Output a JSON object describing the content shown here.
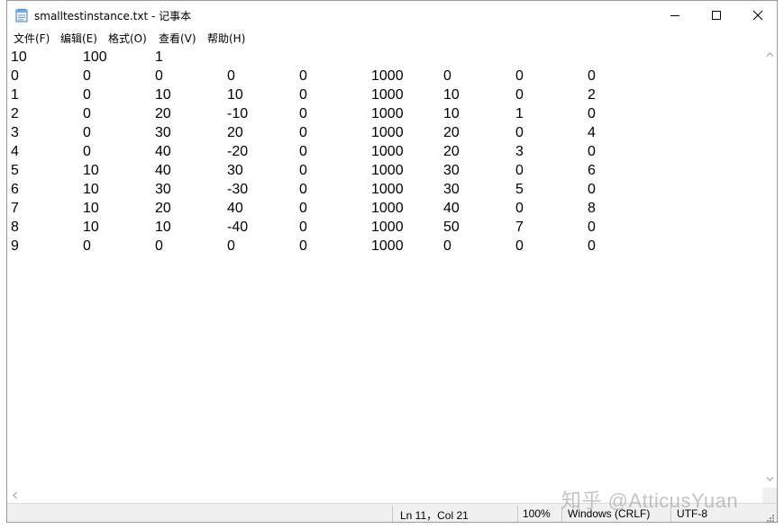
{
  "window": {
    "title": "smalltestinstance.txt - 记事本",
    "icon": "notepad-icon"
  },
  "menu": [
    {
      "label": "文件(F)"
    },
    {
      "label": "编辑(E)"
    },
    {
      "label": "格式(O)"
    },
    {
      "label": "查看(V)"
    },
    {
      "label": "帮助(H)"
    }
  ],
  "content": {
    "rows": [
      [
        "10",
        "100",
        "1"
      ],
      [
        "0",
        "0",
        "0",
        "0",
        "0",
        "1000",
        "0",
        "0",
        "0"
      ],
      [
        "1",
        "0",
        "10",
        "10",
        "0",
        "1000",
        "10",
        "0",
        "2"
      ],
      [
        "2",
        "0",
        "20",
        "-10",
        "0",
        "1000",
        "10",
        "1",
        "0"
      ],
      [
        "3",
        "0",
        "30",
        "20",
        "0",
        "1000",
        "20",
        "0",
        "4"
      ],
      [
        "4",
        "0",
        "40",
        "-20",
        "0",
        "1000",
        "20",
        "3",
        "0"
      ],
      [
        "5",
        "10",
        "40",
        "30",
        "0",
        "1000",
        "30",
        "0",
        "6"
      ],
      [
        "6",
        "10",
        "30",
        "-30",
        "0",
        "1000",
        "30",
        "5",
        "0"
      ],
      [
        "7",
        "10",
        "20",
        "40",
        "0",
        "1000",
        "40",
        "0",
        "8"
      ],
      [
        "8",
        "10",
        "10",
        "-40",
        "0",
        "1000",
        "50",
        "7",
        "0"
      ],
      [
        "9",
        "0",
        "0",
        "0",
        "0",
        "1000",
        "0",
        "0",
        "0"
      ]
    ]
  },
  "status": {
    "position": "Ln 11，Col 21",
    "zoom": "100%",
    "line_ending": "Windows (CRLF)",
    "encoding": "UTF-8"
  },
  "watermark": "知乎 @AtticusYuan"
}
